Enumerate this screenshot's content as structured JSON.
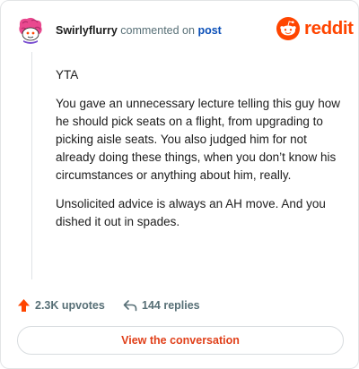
{
  "header": {
    "username": "Swirlyflurry",
    "verb": "commented on",
    "post_link": "post",
    "brand_word": "reddit",
    "brand_color": "#ff4500"
  },
  "comment": {
    "paragraphs": [
      "YTA",
      "You gave an unnecessary lecture telling this guy how he should pick seats on a flight, from upgrading to picking aisle seats. You also judged him for not already doing these things, when you don’t know his circumstances or anything about him, really.",
      "Unsolicited advice is always an AH move. And you dished it out in spades."
    ]
  },
  "actions": {
    "upvotes_label": "2.3K upvotes",
    "replies_label": "144 replies",
    "upvote_icon": "upvote-arrow-icon",
    "reply_icon": "reply-arrow-icon"
  },
  "cta": {
    "label": "View the conversation",
    "color": "#e0401a"
  }
}
